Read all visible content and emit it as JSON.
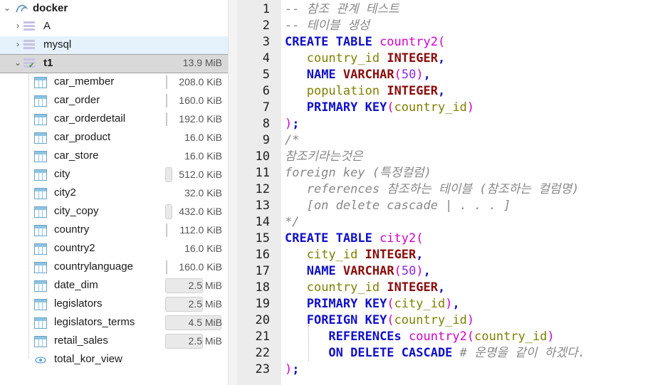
{
  "tree": {
    "root": {
      "label": "docker"
    },
    "databases": [
      {
        "label": "A"
      },
      {
        "label": "mysql"
      },
      {
        "label": "t1",
        "size": "13.9 MiB"
      }
    ],
    "tables": [
      {
        "label": "car_member",
        "size": "208.0 KiB",
        "fill": 0.04
      },
      {
        "label": "car_order",
        "size": "160.0 KiB",
        "fill": 0.03
      },
      {
        "label": "car_orderdetail",
        "size": "192.0 KiB",
        "fill": 0.04
      },
      {
        "label": "car_product",
        "size": "16.0 KiB",
        "fill": 0.0
      },
      {
        "label": "car_store",
        "size": "16.0 KiB",
        "fill": 0.0
      },
      {
        "label": "city",
        "size": "512.0 KiB",
        "fill": 0.1
      },
      {
        "label": "city2",
        "size": "32.0 KiB",
        "fill": 0.0
      },
      {
        "label": "city_copy",
        "size": "432.0 KiB",
        "fill": 0.08
      },
      {
        "label": "country",
        "size": "112.0 KiB",
        "fill": 0.02
      },
      {
        "label": "country2",
        "size": "16.0 KiB",
        "fill": 0.0
      },
      {
        "label": "countrylanguage",
        "size": "160.0 KiB",
        "fill": 0.03
      },
      {
        "label": "date_dim",
        "size": "2.5 MiB",
        "fill": 0.5
      },
      {
        "label": "legislators",
        "size": "2.5 MiB",
        "fill": 0.5
      },
      {
        "label": "legislators_terms",
        "size": "4.5 MiB",
        "fill": 0.9
      },
      {
        "label": "retail_sales",
        "size": "2.5 MiB",
        "fill": 0.5
      }
    ],
    "view": {
      "label": "total_kor_view"
    }
  },
  "editor": {
    "line_numbers": [
      "1",
      "2",
      "3",
      "4",
      "5",
      "6",
      "7",
      "8",
      "9",
      "10",
      "11",
      "12",
      "13",
      "14",
      "15",
      "16",
      "17",
      "18",
      "19",
      "20",
      "21",
      "22",
      "23"
    ],
    "lines": [
      [
        [
          "cm",
          "-- 참조 관계 테스트"
        ]
      ],
      [
        [
          "cm",
          "-- 테이블 생성"
        ]
      ],
      [
        [
          "kw",
          "CREATE TABLE "
        ],
        [
          "tb",
          "country2"
        ],
        [
          "tb",
          "("
        ]
      ],
      [
        [
          "pn",
          "   "
        ],
        [
          "id",
          "country_id"
        ],
        [
          "pn",
          " "
        ],
        [
          "ty",
          "INTEGER"
        ],
        [
          "kw",
          ","
        ]
      ],
      [
        [
          "pn",
          "   "
        ],
        [
          "kw",
          "NAME"
        ],
        [
          "pn",
          " "
        ],
        [
          "ty",
          "VARCHAR"
        ],
        [
          "tb",
          "("
        ],
        [
          "num",
          "50"
        ],
        [
          "tb",
          ")"
        ],
        [
          "kw",
          ","
        ]
      ],
      [
        [
          "pn",
          "   "
        ],
        [
          "id",
          "population"
        ],
        [
          "pn",
          " "
        ],
        [
          "ty",
          "INTEGER"
        ],
        [
          "kw",
          ","
        ]
      ],
      [
        [
          "pn",
          "   "
        ],
        [
          "kw",
          "PRIMARY KEY"
        ],
        [
          "tb",
          "("
        ],
        [
          "id",
          "country_id"
        ],
        [
          "tb",
          ")"
        ]
      ],
      [
        [
          "tb",
          ")"
        ],
        [
          "kw",
          ";"
        ]
      ],
      [
        [
          "cm",
          "/*"
        ]
      ],
      [
        [
          "cm",
          "참조키라는것은"
        ]
      ],
      [
        [
          "cm",
          "foreign key (특정컬럼)"
        ]
      ],
      [
        [
          "cm",
          "   references 참조하는 테이블 (참조하는 컬럼명)"
        ]
      ],
      [
        [
          "cm",
          "   [on delete cascade | . . . ]"
        ]
      ],
      [
        [
          "cm",
          "*/"
        ]
      ],
      [
        [
          "kw",
          "CREATE TABLE "
        ],
        [
          "tb",
          "city2"
        ],
        [
          "tb",
          "("
        ]
      ],
      [
        [
          "pn",
          "   "
        ],
        [
          "id",
          "city_id"
        ],
        [
          "pn",
          " "
        ],
        [
          "ty",
          "INTEGER"
        ],
        [
          "kw",
          ","
        ]
      ],
      [
        [
          "pn",
          "   "
        ],
        [
          "kw",
          "NAME"
        ],
        [
          "pn",
          " "
        ],
        [
          "ty",
          "VARCHAR"
        ],
        [
          "tb",
          "("
        ],
        [
          "num",
          "50"
        ],
        [
          "tb",
          ")"
        ],
        [
          "kw",
          ","
        ]
      ],
      [
        [
          "pn",
          "   "
        ],
        [
          "id",
          "country_id"
        ],
        [
          "pn",
          " "
        ],
        [
          "ty",
          "INTEGER"
        ],
        [
          "kw",
          ","
        ]
      ],
      [
        [
          "pn",
          "   "
        ],
        [
          "kw",
          "PRIMARY KEY"
        ],
        [
          "tb",
          "("
        ],
        [
          "id",
          "city_id"
        ],
        [
          "tb",
          ")"
        ],
        [
          "kw",
          ","
        ]
      ],
      [
        [
          "pn",
          "   "
        ],
        [
          "kw",
          "FOREIGN KEY"
        ],
        [
          "tb",
          "("
        ],
        [
          "id",
          "country_id"
        ],
        [
          "tb",
          ")"
        ]
      ],
      [
        [
          "pn",
          "      "
        ],
        [
          "kw",
          "REFERENCEs "
        ],
        [
          "tb",
          "country2"
        ],
        [
          "tb",
          "("
        ],
        [
          "id",
          "country_id"
        ],
        [
          "tb",
          ")"
        ]
      ],
      [
        [
          "pn",
          "      "
        ],
        [
          "kw",
          "ON DELETE CASCADE"
        ],
        [
          "pn",
          " "
        ],
        [
          "cm",
          "# 운명을 같이 하겠다."
        ]
      ],
      [
        [
          "tb",
          ")"
        ],
        [
          "kw",
          ";"
        ]
      ]
    ]
  }
}
